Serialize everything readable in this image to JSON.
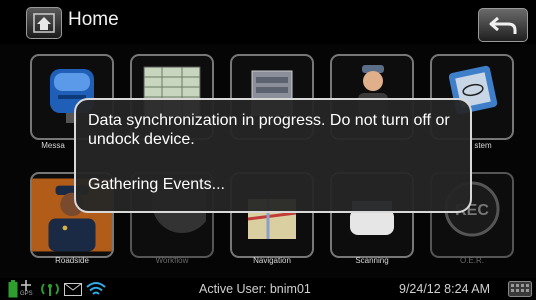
{
  "header": {
    "title": "Home"
  },
  "tiles": [
    {
      "label": "Messaging",
      "icon": "mailbox-icon"
    },
    {
      "label": "",
      "icon": "spreadsheet-icon"
    },
    {
      "label": "",
      "icon": "server-icon"
    },
    {
      "label": "",
      "icon": "driver-icon"
    },
    {
      "label": "System",
      "icon": "chip-icon"
    },
    {
      "label": "Roadside",
      "icon": "officer-icon"
    },
    {
      "label": "Workflow",
      "icon": "workflow-icon"
    },
    {
      "label": "Navigation",
      "icon": "map-icon"
    },
    {
      "label": "Scanning",
      "icon": "scanner-icon"
    },
    {
      "label": "O.E.R.",
      "icon": "rec-icon"
    }
  ],
  "tile_fragments": {
    "messaging_visible": "Messa",
    "system_visible": "stem"
  },
  "rec_text": "REC",
  "dialog": {
    "message": "Data synchronization in progress. Do not turn off or undock device.",
    "status": "Gathering Events..."
  },
  "statusbar": {
    "gps_label": "GPS",
    "active_user": "Active User: bnim01",
    "datetime": "9/24/12 8:24 AM"
  },
  "colors": {
    "battery": "#2e9e2e",
    "signal": "#2db0e8",
    "dialog_border": "#d9d9d9"
  }
}
